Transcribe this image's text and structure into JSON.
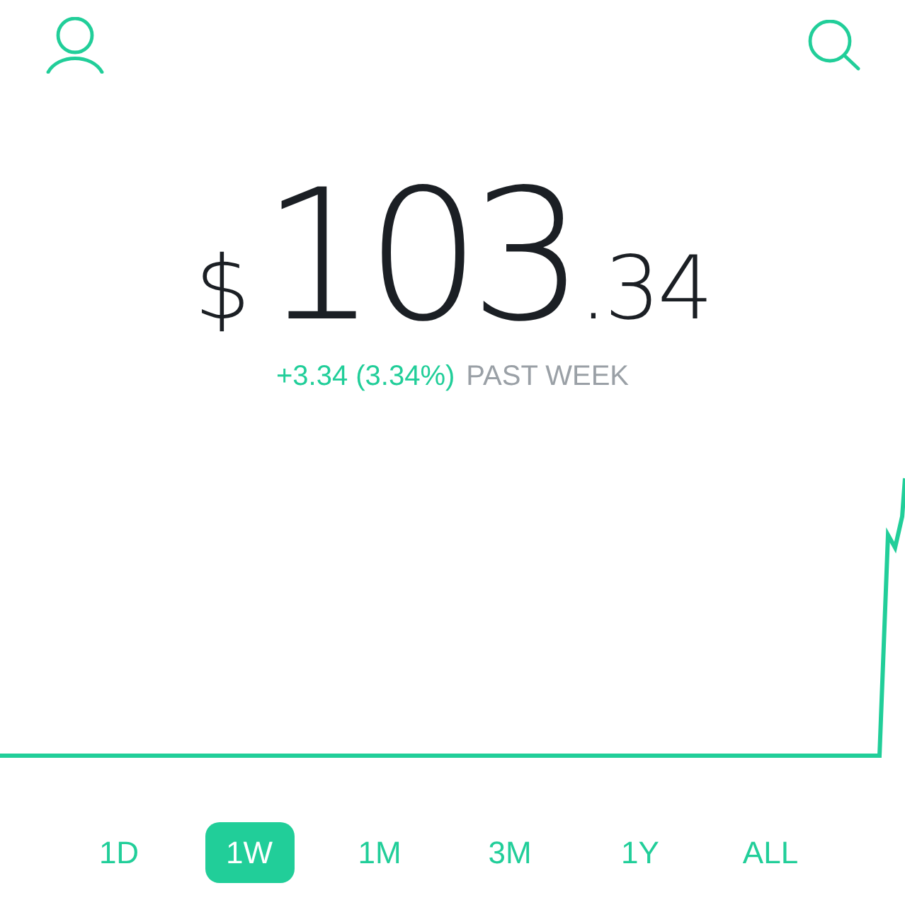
{
  "balance": {
    "currency": "$",
    "whole": "103",
    "cents": ".34"
  },
  "change": {
    "amount": "+3.34 (3.34%)",
    "period": "PAST WEEK"
  },
  "ranges": [
    {
      "label": "1D",
      "selected": false
    },
    {
      "label": "1W",
      "selected": true
    },
    {
      "label": "1M",
      "selected": false
    },
    {
      "label": "3M",
      "selected": false
    },
    {
      "label": "1Y",
      "selected": false
    },
    {
      "label": "ALL",
      "selected": false
    }
  ]
}
